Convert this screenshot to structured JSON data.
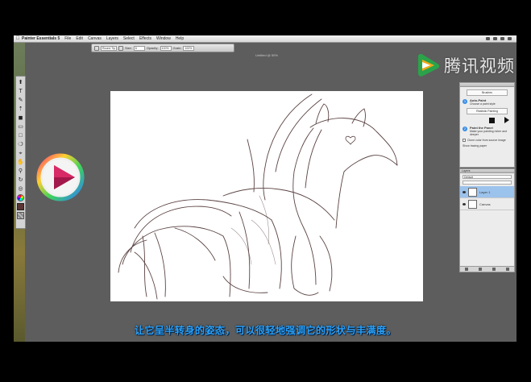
{
  "menubar": {
    "app_name": "Painter Essentials 5",
    "items": [
      "File",
      "Edit",
      "Canvas",
      "Layers",
      "Select",
      "Effects",
      "Window",
      "Help"
    ]
  },
  "property_bar": {
    "brush_field": "Round Tip",
    "size_label": "Size:",
    "size_value": "6",
    "opacity_label": "Opacity:",
    "opacity_value": "100%",
    "grain_label": "Grain:",
    "grain_value": "100%"
  },
  "document": {
    "title": "Untitled @ 50%"
  },
  "watermark": {
    "text": "腾讯视频"
  },
  "brush_panel": {
    "selector_label": "Brushes",
    "variant_label": "Realistic Painting",
    "step1_title": "Auto-Paint",
    "step1_text": "Choose a paint style",
    "step2_title": "Paint the Panel",
    "step2_text": "Make your painting richer and deeper",
    "checkbox_text": "Clone color from source image",
    "restore_text": "Show tracing paper"
  },
  "layers_panel": {
    "title": "Layers",
    "blend_mode": "Default",
    "layers": [
      {
        "name": "Layer 1",
        "selected": true
      },
      {
        "name": "Canvas",
        "selected": false
      }
    ]
  },
  "subtitle": {
    "text": "让它呈半转身的姿态，可以很轻地强调它的形状与丰满度。"
  },
  "colors": {
    "accent": "#3a8ee6",
    "subtitle": "#2aa3ff",
    "sketch_stroke": "#4a2f2f",
    "workspace": "#5d5d5d"
  }
}
